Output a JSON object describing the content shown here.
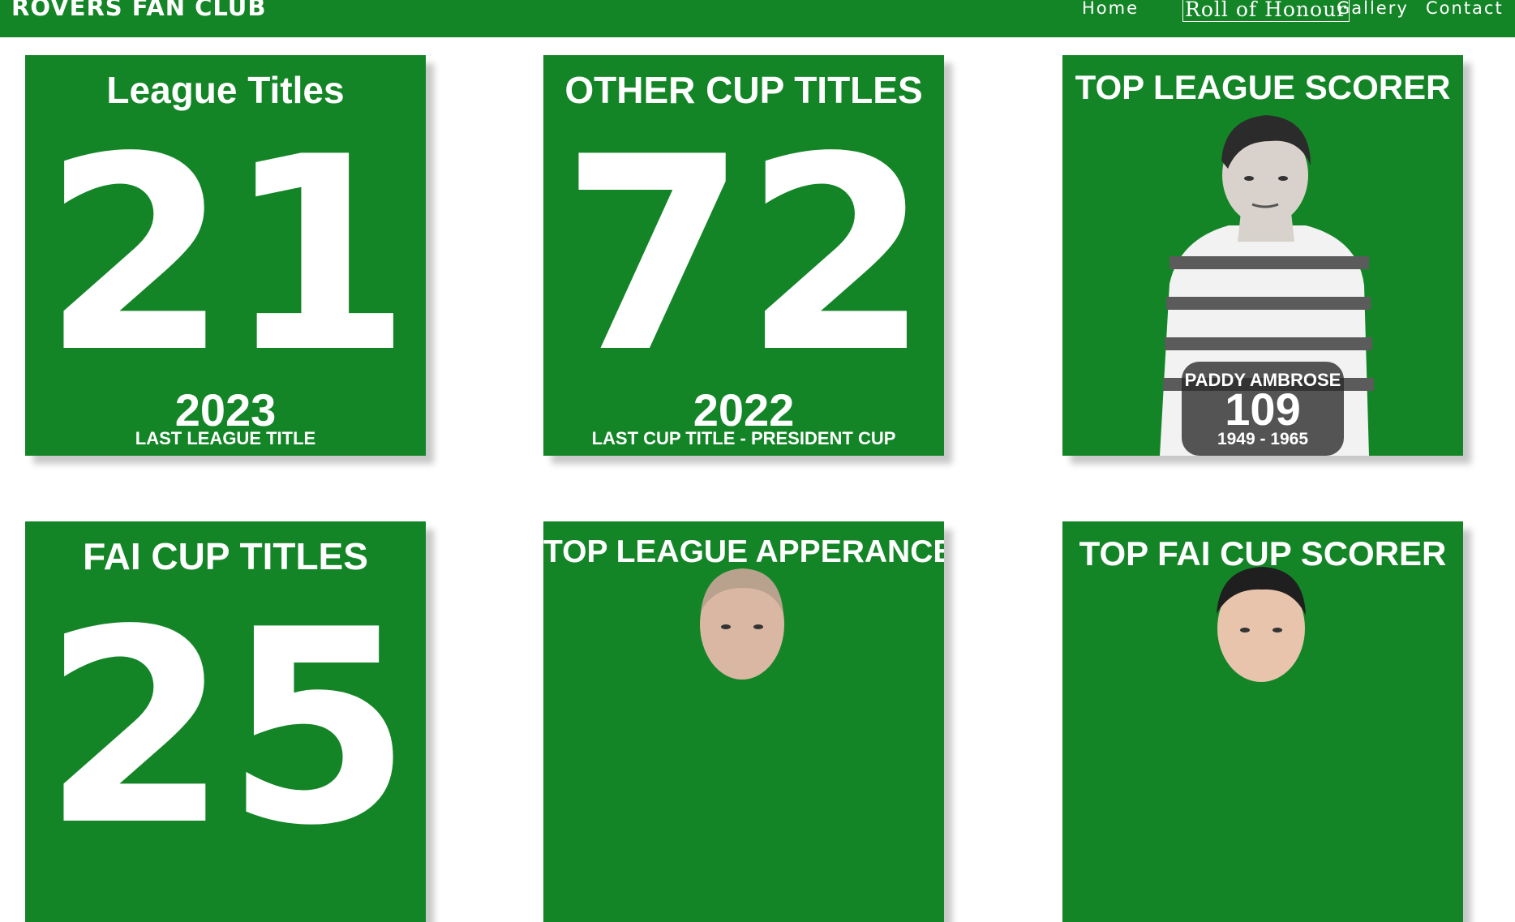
{
  "brand": "ROVERS FAN CLUB",
  "nav": {
    "home": "Home",
    "roll": "Roll of Honour",
    "gallery": "Gallery",
    "contact": "Contact"
  },
  "cards": {
    "league": {
      "title": "League Titles",
      "count": "21",
      "year": "2023",
      "caption": "LAST LEAGUE TITLE"
    },
    "other_cup": {
      "title": "OTHER CUP TITLES",
      "count": "72",
      "year": "2022",
      "caption": "LAST  CUP TITLE - PRESIDENT CUP"
    },
    "top_scorer": {
      "title": "TOP LEAGUE SCORER",
      "name": "PADDY AMBROSE",
      "goals": "109",
      "years": "1949 - 1965"
    },
    "fai_cup": {
      "title": "FAI CUP TITLES",
      "count": "25"
    },
    "top_appearance": {
      "title": "TOP LEAGUE APPERANCE"
    },
    "fai_scorer": {
      "title": "TOP FAI CUP SCORER"
    }
  },
  "colors": {
    "green": "#148527",
    "white": "#ffffff"
  }
}
